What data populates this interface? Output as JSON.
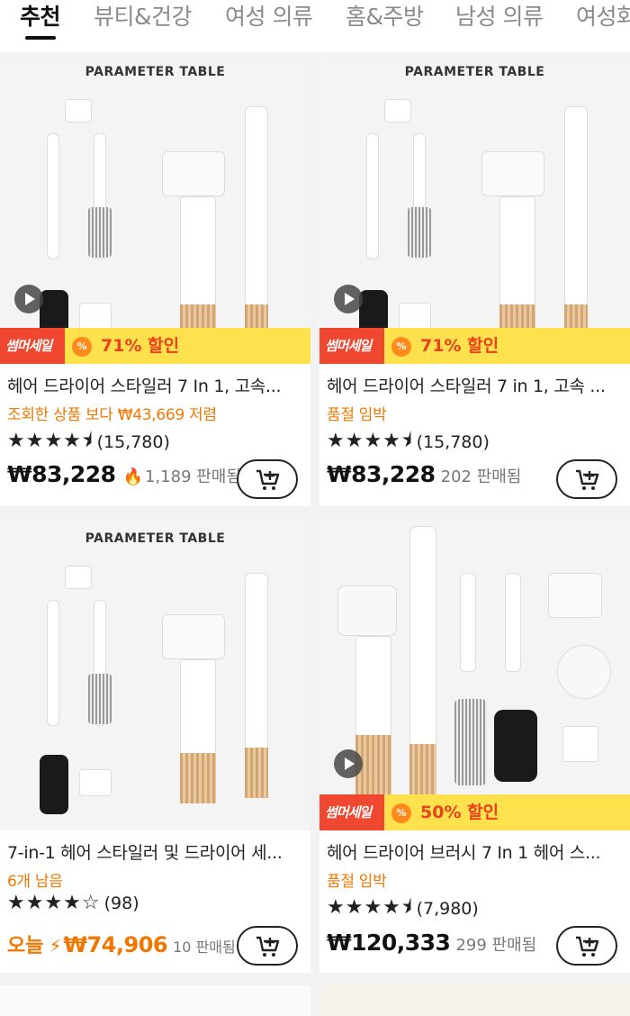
{
  "tabs": [
    {
      "label": "추천",
      "active": true
    },
    {
      "label": "뷰티&건강"
    },
    {
      "label": "여성 의류"
    },
    {
      "label": "홈&주방"
    },
    {
      "label": "남성 의류"
    },
    {
      "label": "여성화"
    }
  ],
  "products": [
    {
      "image_title": "PARAMETER TABLE",
      "banner": {
        "sale_label": "썸머세일",
        "percent_icon": "%",
        "discount": "71% 할인"
      },
      "title": "헤어 드라이어 스타일러 7 In 1, 고속...",
      "subtitle": "조회한 상품 보다 ₩43,669 저렴",
      "rating_stars": 4.5,
      "rating_count": "(15,780)",
      "price": "₩83,228",
      "sold": "1,189 판매됨",
      "sold_icon": "flame-icon"
    },
    {
      "image_title": "PARAMETER TABLE",
      "banner": {
        "sale_label": "썸머세일",
        "percent_icon": "%",
        "discount": "71% 할인"
      },
      "title": "헤어 드라이어 스타일러 7 in 1, 고속 ...",
      "subtitle": "품절 임박",
      "rating_stars": 4.5,
      "rating_count": "(15,780)",
      "price": "₩83,228",
      "sold": "202 판매됨"
    },
    {
      "image_title": "PARAMETER TABLE",
      "title": "7-in-1 헤어 스타일러 및 드라이어 세...",
      "subtitle": "6개 남음",
      "rating_stars": 4.5,
      "rating_count": "(98)",
      "price_prefix": "오늘",
      "price": "₩74,906",
      "sold": "10 판매됨",
      "price_icon": "lightning-icon"
    },
    {
      "banner": {
        "sale_label": "썸머세일",
        "percent_icon": "%",
        "discount": "50% 할인"
      },
      "title": "헤어 드라이어 브러시 7 In 1 헤어 스...",
      "subtitle": "품절 임박",
      "rating_stars": 4.5,
      "rating_count": "(7,980)",
      "price": "₩120,333",
      "sold": "299 판매됨"
    }
  ],
  "stars_text": "★★★★⯨",
  "stars_text_small": "★★★★☆",
  "colors": {
    "accent": "#f07800",
    "sale_red": "#f04830",
    "banner_yellow": "#ffe14d",
    "discount_red": "#e8431c"
  }
}
